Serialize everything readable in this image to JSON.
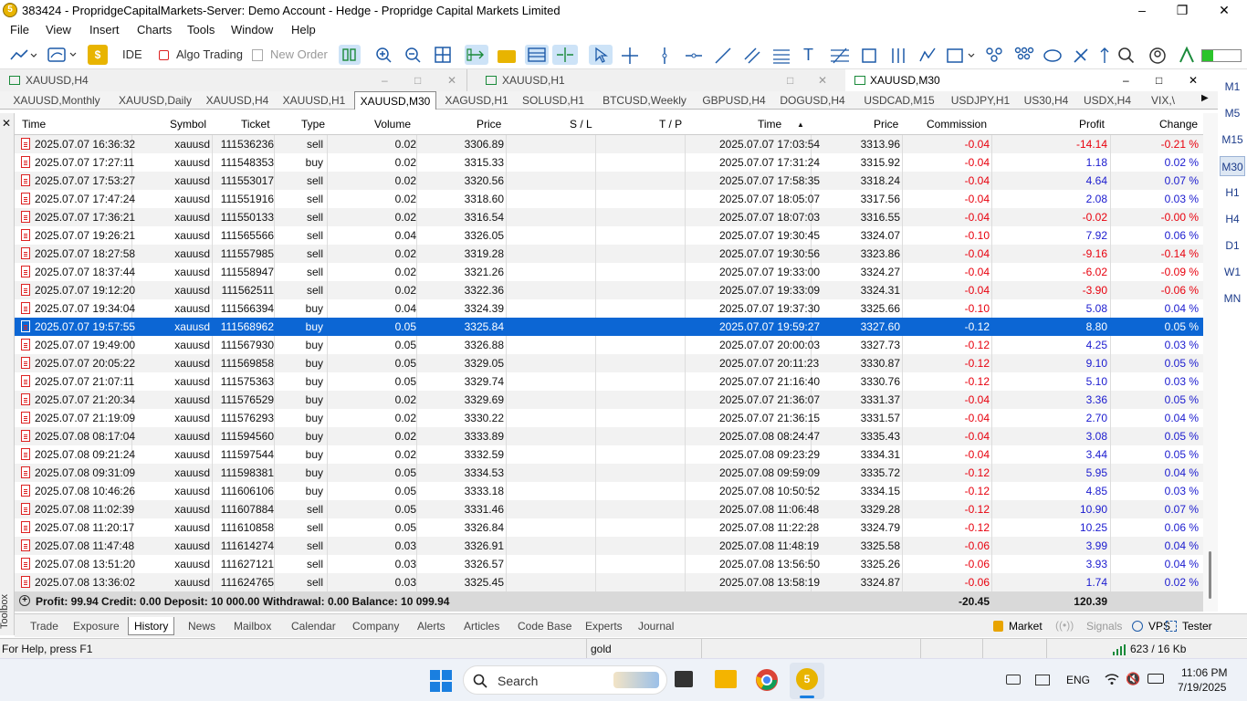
{
  "title": "383424 - PropridgeCapitalMarkets-Server: Demo Account - Hedge - Propridge Capital Markets Limited",
  "menu": [
    "File",
    "View",
    "Insert",
    "Charts",
    "Tools",
    "Window",
    "Help"
  ],
  "toolbar": {
    "ide": "IDE",
    "algo": "Algo Trading",
    "new_order": "New Order"
  },
  "window_tabs": [
    "XAUUSD,H4",
    "XAUUSD,H1",
    "XAUUSD,M30"
  ],
  "symbol_tabs": [
    "XAUUSD,Monthly",
    "XAUUSD,Daily",
    "XAUUSD,H4",
    "XAUUSD,H1",
    "XAUUSD,M30",
    "XAGUSD,H1",
    "SOLUSD,H1",
    "BTCUSD,Weekly",
    "GBPUSD,H4",
    "DOGUSD,H4",
    "USDCAD,M15",
    "USDJPY,H1",
    "US30,H4",
    "USDX,H4",
    "VIX,\\"
  ],
  "timeframes": [
    "M1",
    "M5",
    "M15",
    "M30",
    "H1",
    "H4",
    "D1",
    "W1",
    "MN"
  ],
  "selected_timeframe": "M30",
  "columns": [
    "Time",
    "Symbol",
    "Ticket",
    "Type",
    "Volume",
    "Price",
    "S / L",
    "T / P",
    "Time",
    "Price",
    "Commission",
    "Profit",
    "Change"
  ],
  "rows": [
    [
      "2025.07.07 16:36:32",
      "xauusd",
      "111536236",
      "sell",
      "0.02",
      "3306.89",
      "",
      "",
      "2025.07.07 17:03:54",
      "3313.96",
      "-0.04",
      "-14.14",
      "-0.21 %"
    ],
    [
      "2025.07.07 17:27:11",
      "xauusd",
      "111548353",
      "buy",
      "0.02",
      "3315.33",
      "",
      "",
      "2025.07.07 17:31:24",
      "3315.92",
      "-0.04",
      "1.18",
      "0.02 %"
    ],
    [
      "2025.07.07 17:53:27",
      "xauusd",
      "111553017",
      "sell",
      "0.02",
      "3320.56",
      "",
      "",
      "2025.07.07 17:58:35",
      "3318.24",
      "-0.04",
      "4.64",
      "0.07 %"
    ],
    [
      "2025.07.07 17:47:24",
      "xauusd",
      "111551916",
      "sell",
      "0.02",
      "3318.60",
      "",
      "",
      "2025.07.07 18:05:07",
      "3317.56",
      "-0.04",
      "2.08",
      "0.03 %"
    ],
    [
      "2025.07.07 17:36:21",
      "xauusd",
      "111550133",
      "sell",
      "0.02",
      "3316.54",
      "",
      "",
      "2025.07.07 18:07:03",
      "3316.55",
      "-0.04",
      "-0.02",
      "-0.00 %"
    ],
    [
      "2025.07.07 19:26:21",
      "xauusd",
      "111565566",
      "sell",
      "0.04",
      "3326.05",
      "",
      "",
      "2025.07.07 19:30:45",
      "3324.07",
      "-0.10",
      "7.92",
      "0.06 %"
    ],
    [
      "2025.07.07 18:27:58",
      "xauusd",
      "111557985",
      "sell",
      "0.02",
      "3319.28",
      "",
      "",
      "2025.07.07 19:30:56",
      "3323.86",
      "-0.04",
      "-9.16",
      "-0.14 %"
    ],
    [
      "2025.07.07 18:37:44",
      "xauusd",
      "111558947",
      "sell",
      "0.02",
      "3321.26",
      "",
      "",
      "2025.07.07 19:33:00",
      "3324.27",
      "-0.04",
      "-6.02",
      "-0.09 %"
    ],
    [
      "2025.07.07 19:12:20",
      "xauusd",
      "111562511",
      "sell",
      "0.02",
      "3322.36",
      "",
      "",
      "2025.07.07 19:33:09",
      "3324.31",
      "-0.04",
      "-3.90",
      "-0.06 %"
    ],
    [
      "2025.07.07 19:34:04",
      "xauusd",
      "111566394",
      "buy",
      "0.04",
      "3324.39",
      "",
      "",
      "2025.07.07 19:37:30",
      "3325.66",
      "-0.10",
      "5.08",
      "0.04 %"
    ],
    [
      "2025.07.07 19:57:55",
      "xauusd",
      "111568962",
      "buy",
      "0.05",
      "3325.84",
      "",
      "",
      "2025.07.07 19:59:27",
      "3327.60",
      "-0.12",
      "8.80",
      "0.05 %"
    ],
    [
      "2025.07.07 19:49:00",
      "xauusd",
      "111567930",
      "buy",
      "0.05",
      "3326.88",
      "",
      "",
      "2025.07.07 20:00:03",
      "3327.73",
      "-0.12",
      "4.25",
      "0.03 %"
    ],
    [
      "2025.07.07 20:05:22",
      "xauusd",
      "111569858",
      "buy",
      "0.05",
      "3329.05",
      "",
      "",
      "2025.07.07 20:11:23",
      "3330.87",
      "-0.12",
      "9.10",
      "0.05 %"
    ],
    [
      "2025.07.07 21:07:11",
      "xauusd",
      "111575363",
      "buy",
      "0.05",
      "3329.74",
      "",
      "",
      "2025.07.07 21:16:40",
      "3330.76",
      "-0.12",
      "5.10",
      "0.03 %"
    ],
    [
      "2025.07.07 21:20:34",
      "xauusd",
      "111576529",
      "buy",
      "0.02",
      "3329.69",
      "",
      "",
      "2025.07.07 21:36:07",
      "3331.37",
      "-0.04",
      "3.36",
      "0.05 %"
    ],
    [
      "2025.07.07 21:19:09",
      "xauusd",
      "111576293",
      "buy",
      "0.02",
      "3330.22",
      "",
      "",
      "2025.07.07 21:36:15",
      "3331.57",
      "-0.04",
      "2.70",
      "0.04 %"
    ],
    [
      "2025.07.08 08:17:04",
      "xauusd",
      "111594560",
      "buy",
      "0.02",
      "3333.89",
      "",
      "",
      "2025.07.08 08:24:47",
      "3335.43",
      "-0.04",
      "3.08",
      "0.05 %"
    ],
    [
      "2025.07.08 09:21:24",
      "xauusd",
      "111597544",
      "buy",
      "0.02",
      "3332.59",
      "",
      "",
      "2025.07.08 09:23:29",
      "3334.31",
      "-0.04",
      "3.44",
      "0.05 %"
    ],
    [
      "2025.07.08 09:31:09",
      "xauusd",
      "111598381",
      "buy",
      "0.05",
      "3334.53",
      "",
      "",
      "2025.07.08 09:59:09",
      "3335.72",
      "-0.12",
      "5.95",
      "0.04 %"
    ],
    [
      "2025.07.08 10:46:26",
      "xauusd",
      "111606106",
      "buy",
      "0.05",
      "3333.18",
      "",
      "",
      "2025.07.08 10:50:52",
      "3334.15",
      "-0.12",
      "4.85",
      "0.03 %"
    ],
    [
      "2025.07.08 11:02:39",
      "xauusd",
      "111607884",
      "sell",
      "0.05",
      "3331.46",
      "",
      "",
      "2025.07.08 11:06:48",
      "3329.28",
      "-0.12",
      "10.90",
      "0.07 %"
    ],
    [
      "2025.07.08 11:20:17",
      "xauusd",
      "111610858",
      "sell",
      "0.05",
      "3326.84",
      "",
      "",
      "2025.07.08 11:22:28",
      "3324.79",
      "-0.12",
      "10.25",
      "0.06 %"
    ],
    [
      "2025.07.08 11:47:48",
      "xauusd",
      "111614274",
      "sell",
      "0.03",
      "3326.91",
      "",
      "",
      "2025.07.08 11:48:19",
      "3325.58",
      "-0.06",
      "3.99",
      "0.04 %"
    ],
    [
      "2025.07.08 13:51:20",
      "xauusd",
      "111627121",
      "sell",
      "0.03",
      "3326.57",
      "",
      "",
      "2025.07.08 13:56:50",
      "3325.26",
      "-0.06",
      "3.93",
      "0.04 %"
    ],
    [
      "2025.07.08 13:36:02",
      "xauusd",
      "111624765",
      "sell",
      "0.03",
      "3325.45",
      "",
      "",
      "2025.07.08 13:58:19",
      "3324.87",
      "-0.06",
      "1.74",
      "0.02 %"
    ]
  ],
  "selected_row": 10,
  "summary": {
    "text": "Profit: 99.94  Credit: 0.00  Deposit: 10 000.00  Withdrawal: 0.00  Balance: 10 099.94",
    "commission": "-20.45",
    "profit": "120.39"
  },
  "bottom_tabs": [
    "Trade",
    "Exposure",
    "History",
    "News",
    "Mailbox",
    "Calendar",
    "Company",
    "Alerts",
    "Articles",
    "Code Base",
    "Experts",
    "Journal"
  ],
  "active_bottom_tab": "History",
  "toolbox_label": "Toolbox",
  "right_tabs": [
    "Market",
    "Signals",
    "VPS",
    "Tester"
  ],
  "status": {
    "help": "For Help, press F1",
    "profile": "gold",
    "traffic": "623 / 16 Kb"
  },
  "taskbar": {
    "search": "Search",
    "lang": "ENG",
    "time": "11:06 PM",
    "date": "7/19/2025"
  }
}
